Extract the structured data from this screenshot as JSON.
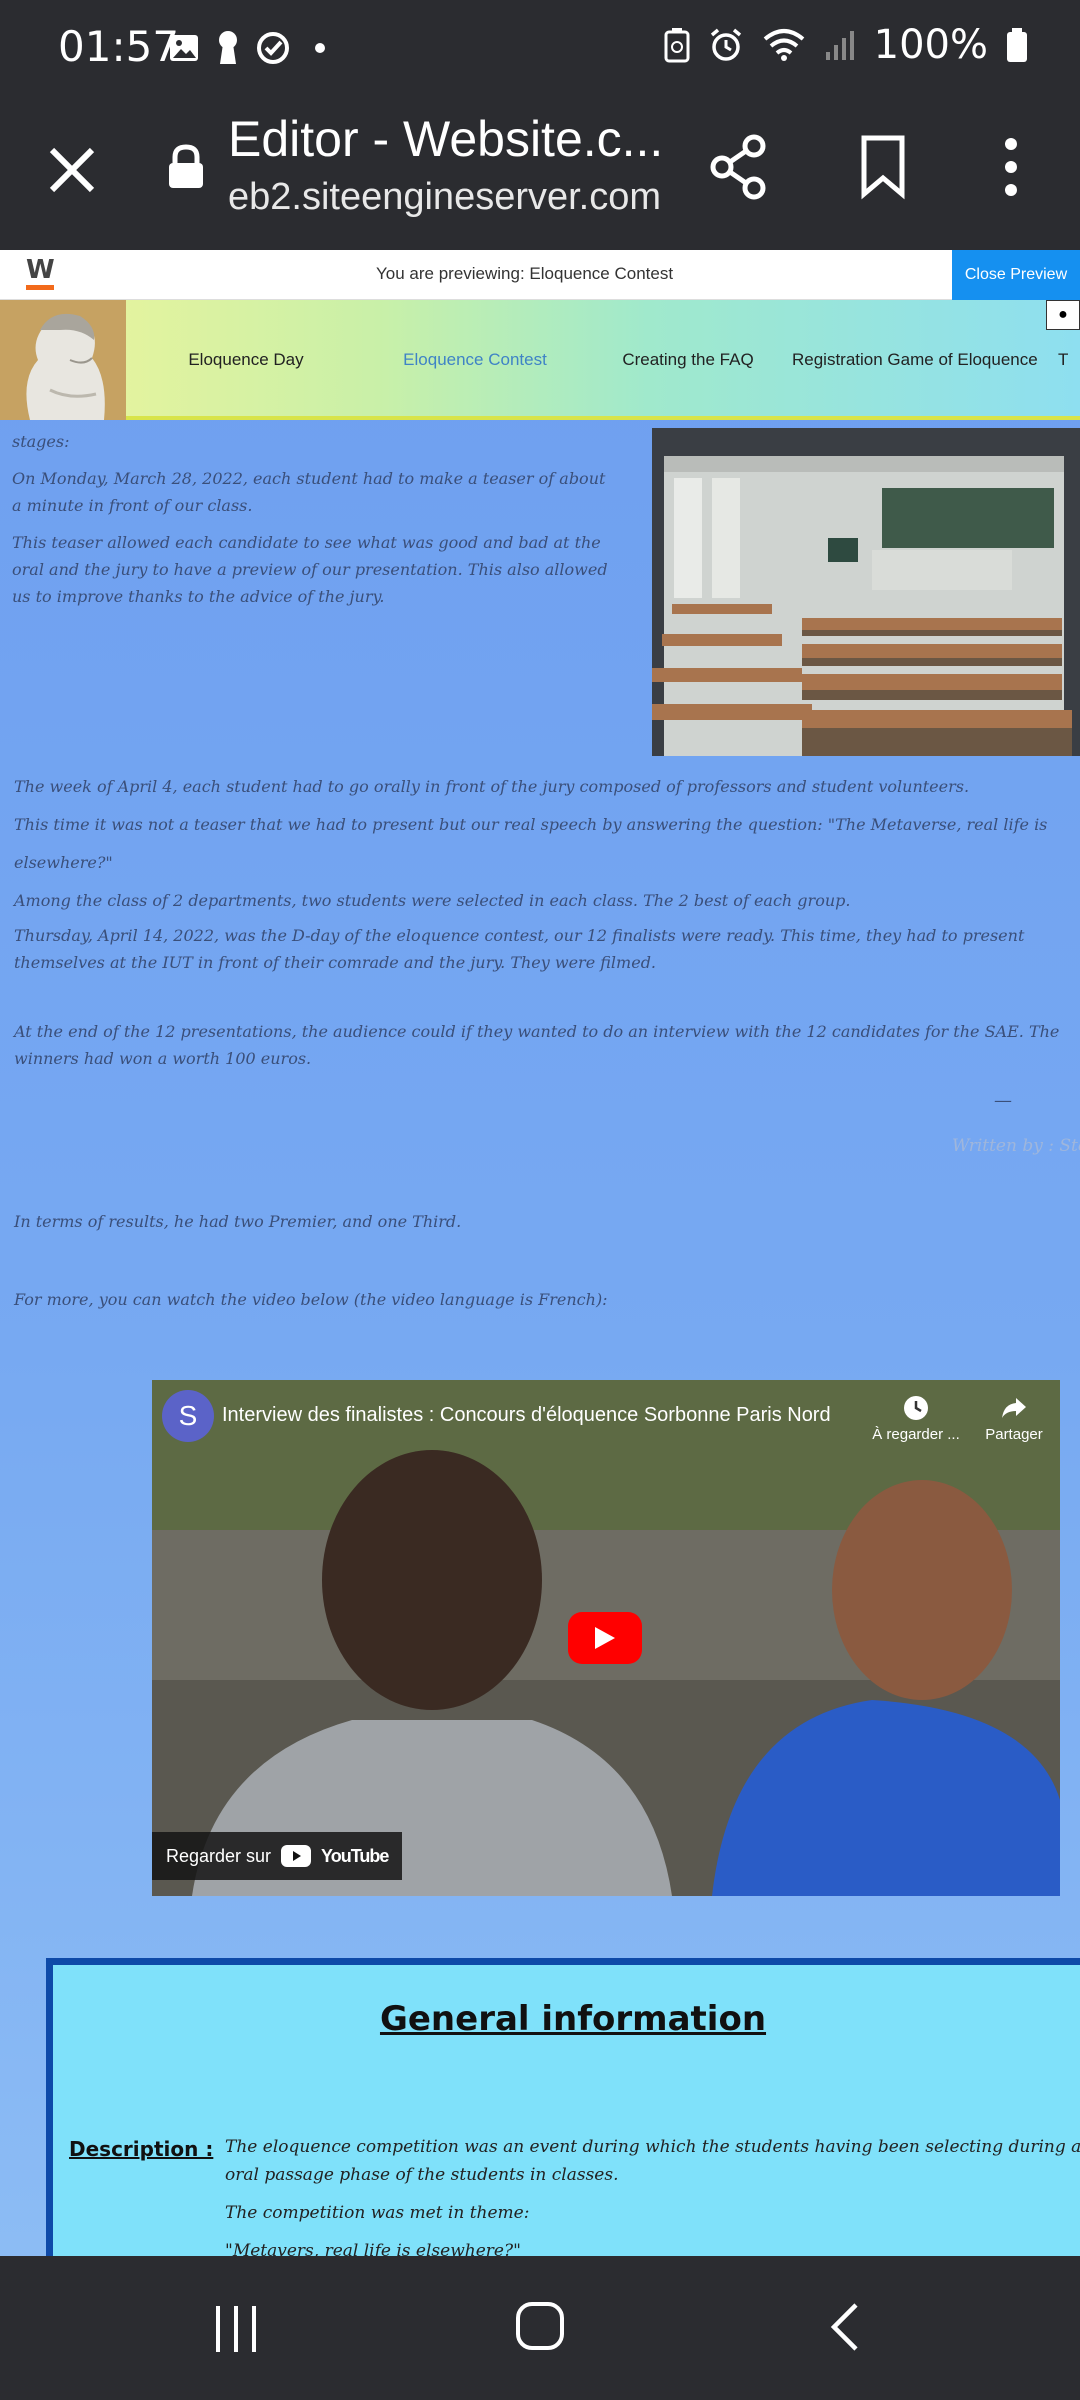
{
  "status_bar": {
    "time": "01:57",
    "battery_text": "100%",
    "icons": [
      "gallery-icon",
      "keyhole-icon",
      "check-circle-icon",
      "dot-icon",
      "battery-saver-icon",
      "alarm-icon",
      "wifi-icon",
      "signal-icon",
      "battery-icon"
    ]
  },
  "browser": {
    "title": "Editor - Website.c...",
    "url": "eb2.siteengineserver.com",
    "icons": [
      "close-icon",
      "lock-icon",
      "share-icon",
      "bookmark-icon",
      "more-icon"
    ]
  },
  "preview_bar": {
    "logo": "W",
    "text": "You are previewing: Eloquence Contest",
    "close_label": "Close Preview"
  },
  "site_nav": {
    "items": [
      "Eloquence Day",
      "Eloquence Contest",
      "Creating the FAQ",
      "Registration Game of Eloquence",
      "T"
    ],
    "active": "Eloquence Contest"
  },
  "content": {
    "para_top_clipped": "stages:",
    "para_march": "On Monday, March 28, 2022, each student had to make a teaser of about a minute in front of our class.",
    "para_teaser": "This teaser allowed each candidate to see what was good and bad at the oral and the jury to have a preview of our presentation. This also allowed us to improve thanks to the advice of the jury.",
    "para_april4": "The week of April 4, each student had to go orally in front of the jury composed of professors and student volunteers.",
    "para_speech": "This time it was not a teaser that we had to present but our real speech by answering the question: \"The Metaverse, real life is elsewhere?\"",
    "para_selected": "Among the class of 2 departments, two students were selected in each class. The 2 best of each group.",
    "para_thursday": "Thursday, April 14, 2022, was the D-day of the eloquence contest, our 12 finalists were ready. This time, they had to present themselves at the IUT in front of their comrade and the jury. They were filmed.",
    "para_end": "At the end of the 12 presentations, the audience could if they wanted to do an interview with the 12 candidates for the SAE. The winners had won a worth 100 euros.",
    "dash": "—",
    "written_by": "Written by : Stev",
    "para_results": "In terms of results, he had two Premier, and one Third.",
    "para_more": "For more, you can watch the video below (the video language is French):"
  },
  "video": {
    "avatar_letter": "S",
    "title": "Interview des finalistes : Concours d'éloquence Sorbonne Paris Nord",
    "watch_later": "À regarder ...",
    "share": "Partager",
    "watch_on": "Regarder sur",
    "youtube": "YouTube"
  },
  "info": {
    "title": "General information",
    "description_label": "Description :",
    "desc_1": "The eloquence competition was an event during which the students having been selecting during an oral passage phase of the students in classes.",
    "desc_2": "The competition was met in theme:",
    "desc_3": "\"Metavers, real life is elsewhere?\""
  },
  "nav_bar": {
    "icons": [
      "recent-apps-icon",
      "home-icon",
      "back-icon"
    ]
  }
}
